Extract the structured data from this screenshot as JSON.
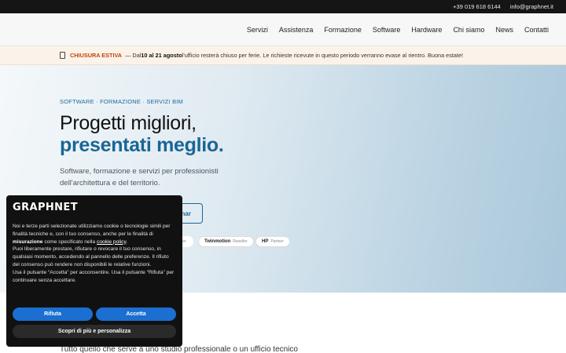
{
  "topbar": {
    "phone": "+39 019 618 6144",
    "email": "info@graphnet.it"
  },
  "nav": [
    "Servizi",
    "Assistenza",
    "Formazione",
    "Software",
    "Hardware",
    "Chi siamo",
    "News",
    "Contatti"
  ],
  "notice": {
    "title": "CHIUSURA ESTIVA",
    "p1": "— Dal ",
    "d1": "10 al 21 agosto",
    "p2": " l'ufficio resterà chiuso per ferie. Le richieste ricevute in questo periodo verranno evase al rientro. Buona estate!"
  },
  "hero": {
    "kicker": "SOFTWARE · FORMAZIONE · SERVIZI BIM",
    "title1": "Progetti migliori,",
    "title2": "presentati meglio.",
    "subtitle": "Software, formazione e servizi per professionisti dell'architettura e del territorio.",
    "button_partial": "nar",
    "chip_ghost": "tner",
    "chips": [
      {
        "name": "Twinmotion",
        "role": "Reseller"
      },
      {
        "name": "HP",
        "role": "Partner"
      }
    ]
  },
  "below": "Tutto quello che serve a uno studio professionale o un ufficio tecnico",
  "cookie": {
    "logo": "GRAPHNET",
    "t1": "Noi e terze parti selezionate utilizziamo cookie o tecnologie simili per finalità tecniche e, con il tuo consenso, anche per le finalità di ",
    "t1b": "misurazione",
    "t2": " come specificato nella ",
    "link": "cookie policy",
    "t3": ".",
    "t4": "Puoi liberamente prestare, rifiutare o revocare il tuo consenso, in qualsiasi momento, accedendo al pannello delle preferenze. Il rifiuto del consenso può rendere non disponibili le relative funzioni.",
    "t5": "Usa il pulsante “Accetta” per acconsentire. Usa il pulsante “Rifiuta” per continuare senza accettare.",
    "reject": "Rifiuta",
    "accept": "Accetta",
    "customize": "Scopri di più e personalizza"
  }
}
